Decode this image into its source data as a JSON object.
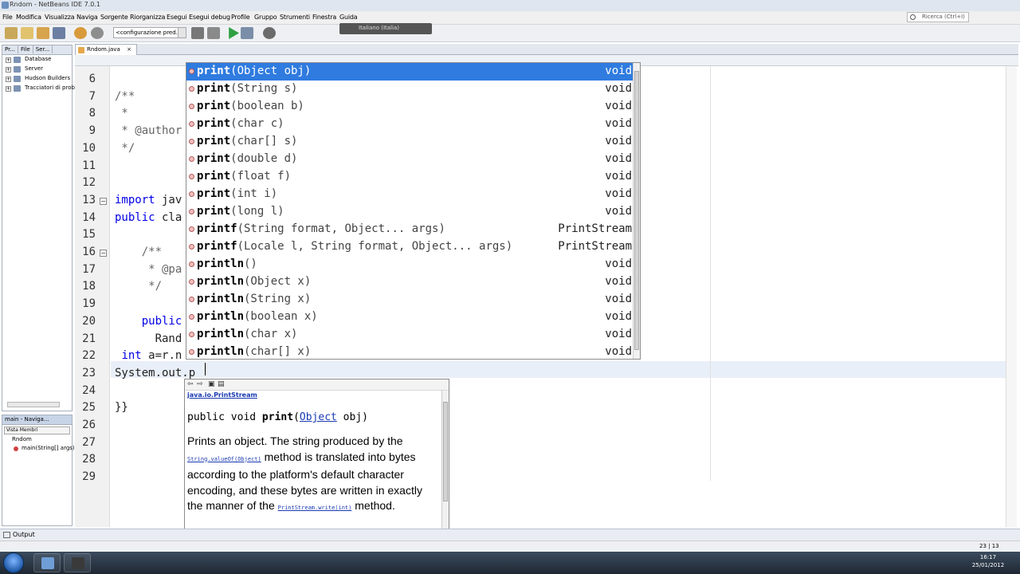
{
  "window": {
    "title": "Rndom - NetBeans IDE 7.0.1"
  },
  "menu": [
    "File",
    "Modifica",
    "Visualizza",
    "Naviga",
    "Sorgente",
    "Riorganizza",
    "Esegui",
    "Esegui debug",
    "Profile",
    "Gruppo",
    "Strumenti",
    "Finestra",
    "Guida"
  ],
  "search": {
    "placeholder": "Ricerca (Ctrl+I)"
  },
  "toolbar": {
    "config": "<configurazione pred..."
  },
  "language_indicator": "Italiano (Italia)",
  "projects_panel": {
    "tabs": [
      "Pr...",
      "File",
      "Ser..."
    ],
    "items": [
      "Database",
      "Server",
      "Hudson Builders",
      "Tracciatori di probl"
    ]
  },
  "navigator": {
    "title": "main - Naviga...",
    "view": "Vista Membri",
    "items": [
      "Rndom",
      "main(String[] args)"
    ]
  },
  "editor": {
    "tab": "Rndom.java",
    "lines": [
      {
        "n": "6",
        "text": ""
      },
      {
        "n": "7",
        "text": "/**"
      },
      {
        "n": "8",
        "text": " *"
      },
      {
        "n": "9",
        "text": " * @author"
      },
      {
        "n": "10",
        "text": " */"
      },
      {
        "n": "11",
        "text": ""
      },
      {
        "n": "12",
        "text": ""
      },
      {
        "n": "13",
        "text": "import jav"
      },
      {
        "n": "14",
        "text": "public cla"
      },
      {
        "n": "15",
        "text": ""
      },
      {
        "n": "16",
        "text": "    /**"
      },
      {
        "n": "17",
        "text": "     * @pa"
      },
      {
        "n": "18",
        "text": "     */"
      },
      {
        "n": "19",
        "text": ""
      },
      {
        "n": "20",
        "text": "    public"
      },
      {
        "n": "21",
        "text": "      Rand"
      },
      {
        "n": "22",
        "text": " int a=r.n"
      },
      {
        "n": "23",
        "text": "System.out.p"
      },
      {
        "n": "24",
        "text": ""
      },
      {
        "n": "25",
        "text": "}}"
      },
      {
        "n": "26",
        "text": ""
      },
      {
        "n": "27",
        "text": ""
      },
      {
        "n": "28",
        "text": ""
      },
      {
        "n": "29",
        "text": ""
      }
    ]
  },
  "completion": [
    {
      "name": "print",
      "args": "(Object obj)",
      "ret": "void"
    },
    {
      "name": "print",
      "args": "(String s)",
      "ret": "void"
    },
    {
      "name": "print",
      "args": "(boolean b)",
      "ret": "void"
    },
    {
      "name": "print",
      "args": "(char c)",
      "ret": "void"
    },
    {
      "name": "print",
      "args": "(char[] s)",
      "ret": "void"
    },
    {
      "name": "print",
      "args": "(double d)",
      "ret": "void"
    },
    {
      "name": "print",
      "args": "(float f)",
      "ret": "void"
    },
    {
      "name": "print",
      "args": "(int i)",
      "ret": "void"
    },
    {
      "name": "print",
      "args": "(long l)",
      "ret": "void"
    },
    {
      "name": "printf",
      "args": "(String format, Object... args)",
      "ret": "PrintStream"
    },
    {
      "name": "printf",
      "args": "(Locale l, String format, Object... args)",
      "ret": "PrintStream"
    },
    {
      "name": "println",
      "args": "()",
      "ret": "void"
    },
    {
      "name": "println",
      "args": "(Object x)",
      "ret": "void"
    },
    {
      "name": "println",
      "args": "(String x)",
      "ret": "void"
    },
    {
      "name": "println",
      "args": "(boolean x)",
      "ret": "void"
    },
    {
      "name": "println",
      "args": "(char x)",
      "ret": "void"
    },
    {
      "name": "println",
      "args": "(char[] x)",
      "ret": "void"
    }
  ],
  "javadoc": {
    "package": "java.io.PrintStream",
    "sig_prefix": "public void ",
    "sig_name": "print",
    "sig_open": "(",
    "sig_type": "Object",
    "sig_rest": " obj)",
    "p1": "Prints an object. The string produced by the ",
    "link1": "String.valueOf(Object)",
    "p2": " method is translated into bytes according to the platform's default character encoding, and these bytes are written in exactly the manner of the ",
    "link2": "PrintStream.write(int)",
    "p3": " method."
  },
  "output_tab": "Output",
  "status": {
    "position": "23 | 13"
  },
  "tray": {
    "time": "16:17",
    "date": "25/01/2012"
  },
  "colors": {
    "selection": "#2f7bdf",
    "keyword": "#0000e6",
    "link": "#1a3ab2"
  }
}
